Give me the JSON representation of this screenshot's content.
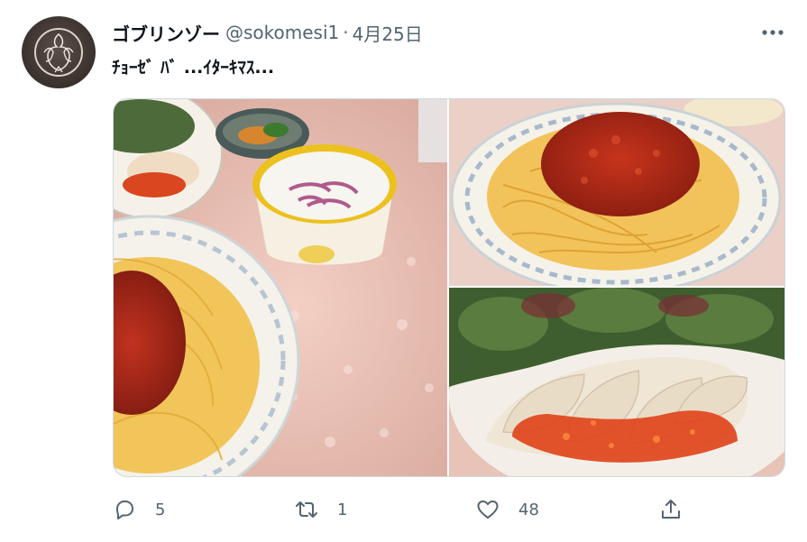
{
  "tweet": {
    "author_name": "ゴブリンゾー",
    "handle": "@sokomesi1",
    "separator": "·",
    "date": "4月25日",
    "text": "ﾁｮｰｾﾞ ﾊﾞ ...ｲﾀｰｷﾏｽ..."
  },
  "actions": {
    "reply_count": "5",
    "retweet_count": "1",
    "like_count": "48"
  },
  "icons": {
    "avatar": "crane-crest-icon",
    "more": "more-horizontal-icon",
    "reply": "reply-icon",
    "retweet": "retweet-icon",
    "like": "heart-icon",
    "share": "share-icon"
  },
  "colors": {
    "text_primary": "#0f1419",
    "text_secondary": "#536471",
    "border": "#cfd9de"
  }
}
